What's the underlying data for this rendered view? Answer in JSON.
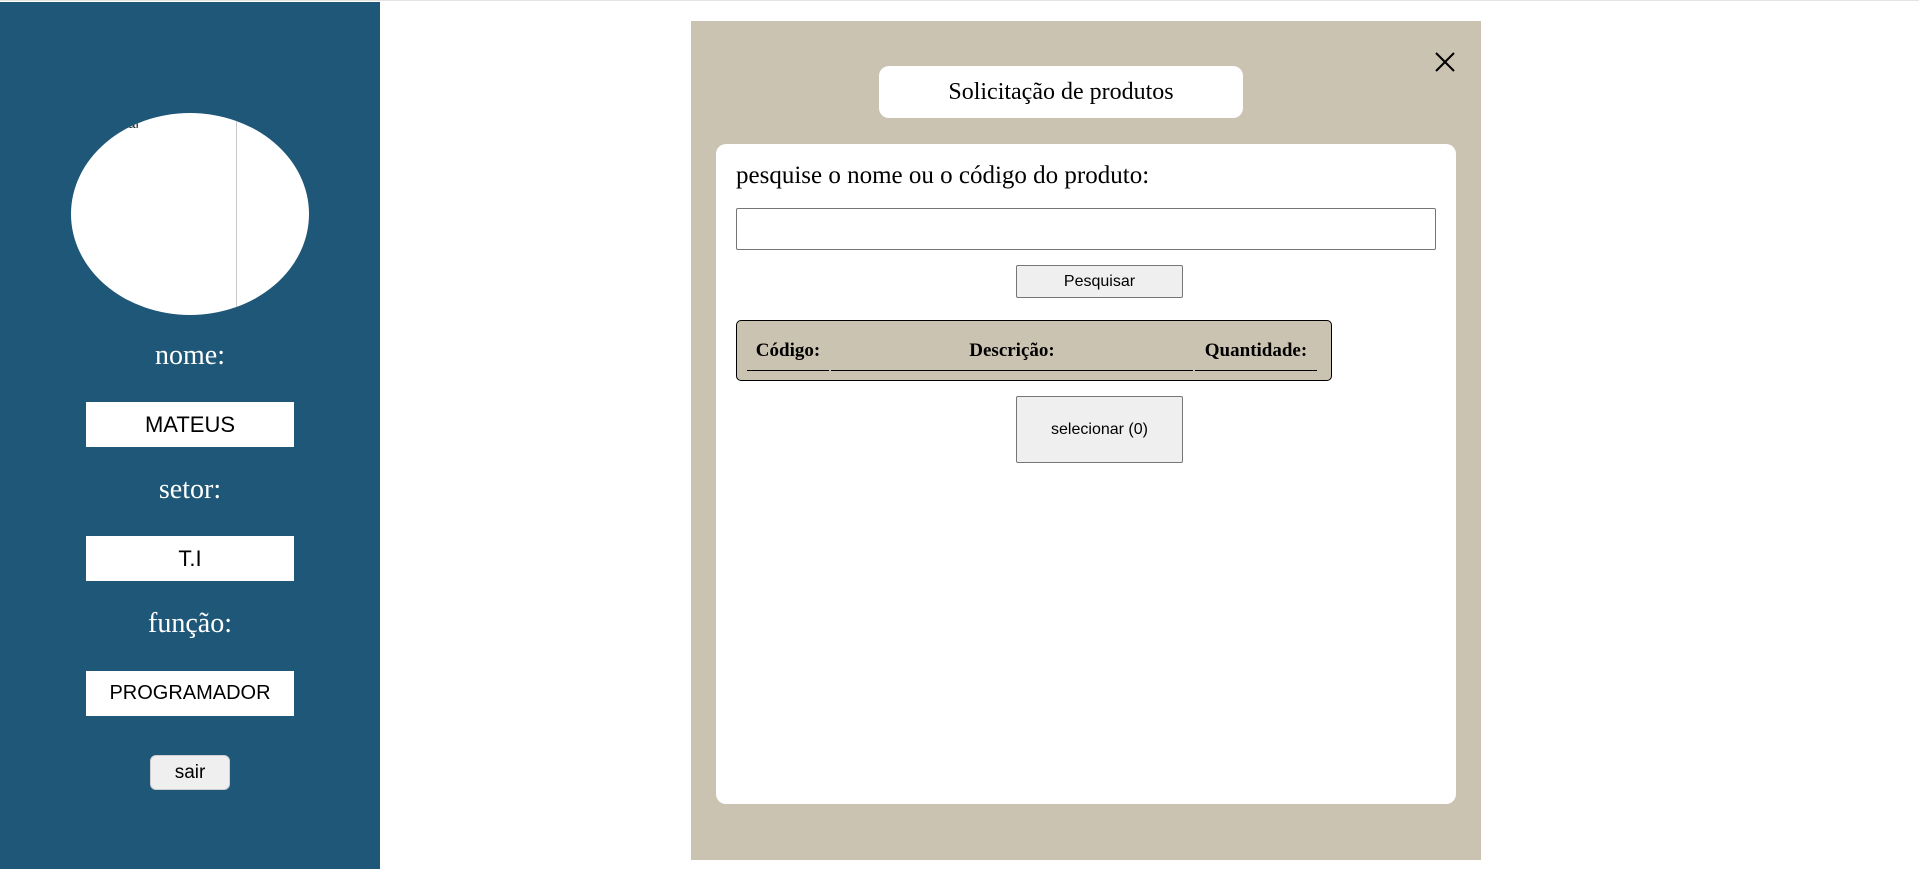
{
  "sidebar": {
    "avatar_alt": "ual",
    "name_label": "nome:",
    "name_value": "MATEUS",
    "sector_label": "setor:",
    "sector_value": "T.I",
    "role_label": "função:",
    "role_value": "PROGRAMADOR",
    "logout_label": "sair"
  },
  "modal": {
    "title": "Solicitação de produtos",
    "close_icon": "close-icon",
    "search_label": "pesquise o nome ou o código do produto:",
    "search_value": "",
    "search_button": "Pesquisar",
    "table": {
      "headers": [
        "Código:",
        "Descrição:",
        "Quantidade:"
      ],
      "rows": []
    },
    "select_button": "selecionar (0)"
  },
  "colors": {
    "sidebar_bg": "#1e5777",
    "modal_bg": "#cbc3b2",
    "panel_bg": "#ffffff"
  }
}
